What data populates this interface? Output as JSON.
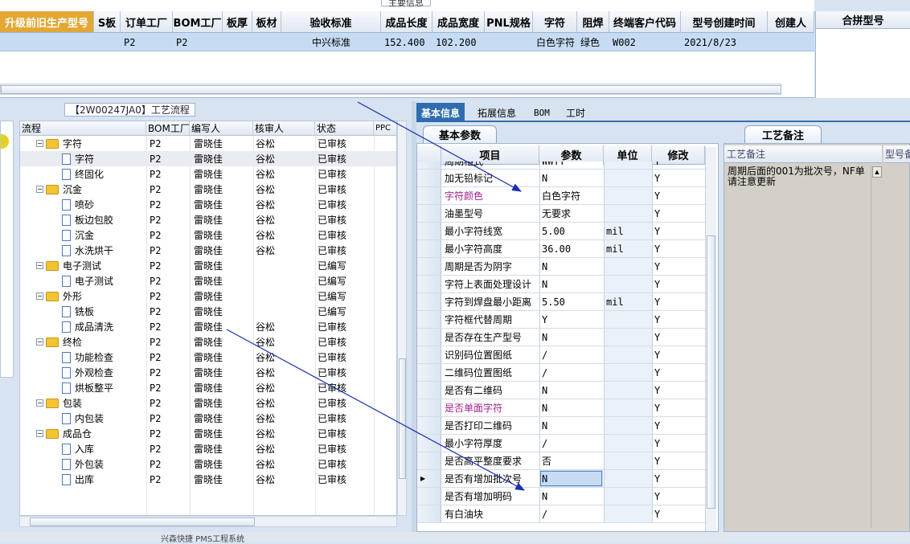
{
  "top_section": {
    "caption": "主要信息",
    "columns": [
      "升级前旧生产型号",
      "S板",
      "订单工厂",
      "BOM工厂",
      "板厚",
      "板材",
      "验收标准",
      "成品长度",
      "成品宽度",
      "PNL规格",
      "字符",
      "阻焊",
      "终端客户代码",
      "型号创建时间",
      "创建人"
    ],
    "row": [
      "",
      "",
      "P2",
      "P2",
      "",
      "",
      "中兴标准",
      "152.400",
      "102.200",
      "",
      "白色字符",
      "绿色",
      "W002",
      "2021/8/23",
      ""
    ],
    "merge_header": "合拼型号"
  },
  "left_section": {
    "caption": "【2W00247JA0】工艺流程",
    "columns": [
      "流程",
      "BOM工厂",
      "编写人",
      "核审人",
      "状态",
      "PPC"
    ],
    "rows": [
      {
        "level": 0,
        "type": "folder",
        "name": "字符",
        "bom": "P2",
        "writer": "雷晓佳",
        "reviewer": "谷松",
        "status": "已审核"
      },
      {
        "level": 1,
        "type": "doc",
        "name": "字符",
        "bom": "P2",
        "writer": "雷晓佳",
        "reviewer": "谷松",
        "status": "已审核",
        "selected": true
      },
      {
        "level": 1,
        "type": "doc",
        "name": "终固化",
        "bom": "P2",
        "writer": "雷晓佳",
        "reviewer": "谷松",
        "status": "已审核"
      },
      {
        "level": 0,
        "type": "folder",
        "name": "沉金",
        "bom": "P2",
        "writer": "雷晓佳",
        "reviewer": "谷松",
        "status": "已审核"
      },
      {
        "level": 1,
        "type": "doc",
        "name": "喷砂",
        "bom": "P2",
        "writer": "雷晓佳",
        "reviewer": "谷松",
        "status": "已审核"
      },
      {
        "level": 1,
        "type": "doc",
        "name": "板边包胶",
        "bom": "P2",
        "writer": "雷晓佳",
        "reviewer": "谷松",
        "status": "已审核"
      },
      {
        "level": 1,
        "type": "doc",
        "name": "沉金",
        "bom": "P2",
        "writer": "雷晓佳",
        "reviewer": "谷松",
        "status": "已审核"
      },
      {
        "level": 1,
        "type": "doc",
        "name": "水洗烘干",
        "bom": "P2",
        "writer": "雷晓佳",
        "reviewer": "谷松",
        "status": "已审核"
      },
      {
        "level": 0,
        "type": "folder",
        "name": "电子测试",
        "bom": "P2",
        "writer": "雷晓佳",
        "reviewer": "",
        "status": "已编写"
      },
      {
        "level": 1,
        "type": "doc",
        "name": "电子测试",
        "bom": "P2",
        "writer": "雷晓佳",
        "reviewer": "",
        "status": "已编写"
      },
      {
        "level": 0,
        "type": "folder",
        "name": "外形",
        "bom": "P2",
        "writer": "雷晓佳",
        "reviewer": "",
        "status": "已编写"
      },
      {
        "level": 1,
        "type": "doc",
        "name": "铣板",
        "bom": "P2",
        "writer": "雷晓佳",
        "reviewer": "",
        "status": "已编写"
      },
      {
        "level": 1,
        "type": "doc",
        "name": "成品清洗",
        "bom": "P2",
        "writer": "雷晓佳",
        "reviewer": "谷松",
        "status": "已审核"
      },
      {
        "level": 0,
        "type": "folder",
        "name": "终检",
        "bom": "P2",
        "writer": "雷晓佳",
        "reviewer": "谷松",
        "status": "已审核"
      },
      {
        "level": 1,
        "type": "doc",
        "name": "功能检查",
        "bom": "P2",
        "writer": "雷晓佳",
        "reviewer": "谷松",
        "status": "已审核"
      },
      {
        "level": 1,
        "type": "doc",
        "name": "外观检查",
        "bom": "P2",
        "writer": "雷晓佳",
        "reviewer": "谷松",
        "status": "已审核"
      },
      {
        "level": 1,
        "type": "doc",
        "name": "烘板整平",
        "bom": "P2",
        "writer": "雷晓佳",
        "reviewer": "谷松",
        "status": "已审核"
      },
      {
        "level": 0,
        "type": "folder",
        "name": "包装",
        "bom": "P2",
        "writer": "雷晓佳",
        "reviewer": "谷松",
        "status": "已审核"
      },
      {
        "level": 1,
        "type": "doc",
        "name": "内包装",
        "bom": "P2",
        "writer": "雷晓佳",
        "reviewer": "谷松",
        "status": "已审核"
      },
      {
        "level": 0,
        "type": "folder",
        "name": "成品仓",
        "bom": "P2",
        "writer": "雷晓佳",
        "reviewer": "谷松",
        "status": "已审核"
      },
      {
        "level": 1,
        "type": "doc",
        "name": "入库",
        "bom": "P2",
        "writer": "雷晓佳",
        "reviewer": "谷松",
        "status": "已审核"
      },
      {
        "level": 1,
        "type": "doc",
        "name": "外包装",
        "bom": "P2",
        "writer": "雷晓佳",
        "reviewer": "谷松",
        "status": "已审核"
      },
      {
        "level": 1,
        "type": "doc",
        "name": "出库",
        "bom": "P2",
        "writer": "雷晓佳",
        "reviewer": "谷松",
        "status": "已审核"
      }
    ]
  },
  "right_section": {
    "tabs": [
      "基本信息",
      "拓展信息",
      "BOM",
      "工时"
    ],
    "active_tab": 0,
    "subtab": "基本参数",
    "remark_tab": "工艺备注",
    "param_columns": [
      "项目",
      "参数",
      "单位",
      "修改"
    ],
    "params": [
      {
        "item": "周期格式",
        "value": "WWYY",
        "unit": "",
        "mod": "Y"
      },
      {
        "item": "加无铅标记",
        "value": "N",
        "unit": "",
        "mod": "Y"
      },
      {
        "item": "字符颜色",
        "value": "白色字符",
        "unit": "",
        "mod": "Y",
        "highlight": true
      },
      {
        "item": "油墨型号",
        "value": "无要求",
        "unit": "",
        "mod": "Y"
      },
      {
        "item": "最小字符线宽",
        "value": "5.00",
        "unit": "mil",
        "mod": "Y"
      },
      {
        "item": "最小字符高度",
        "value": "36.00",
        "unit": "mil",
        "mod": "Y"
      },
      {
        "item": "周期是否为阴字",
        "value": "N",
        "unit": "",
        "mod": "Y"
      },
      {
        "item": "字符上表面处理设计",
        "value": "N",
        "unit": "",
        "mod": "Y"
      },
      {
        "item": "字符到焊盘最小距离",
        "value": "5.50",
        "unit": "mil",
        "mod": "Y"
      },
      {
        "item": "字符框代替周期",
        "value": "Y",
        "unit": "",
        "mod": "Y"
      },
      {
        "item": "是否存在生产型号",
        "value": "N",
        "unit": "",
        "mod": "Y"
      },
      {
        "item": "识别码位置图纸",
        "value": "/",
        "unit": "",
        "mod": "Y"
      },
      {
        "item": "二维码位置图纸",
        "value": "/",
        "unit": "",
        "mod": "Y"
      },
      {
        "item": "是否有二维码",
        "value": "N",
        "unit": "",
        "mod": "Y"
      },
      {
        "item": "是否单面字符",
        "value": "N",
        "unit": "",
        "mod": "Y",
        "highlight": true
      },
      {
        "item": "是否打印二维码",
        "value": "N",
        "unit": "",
        "mod": "Y"
      },
      {
        "item": "最小字符厚度",
        "value": "/",
        "unit": "",
        "mod": "Y"
      },
      {
        "item": "是否高平整度要求",
        "value": "否",
        "unit": "",
        "mod": "Y"
      },
      {
        "item": "是否有增加批次号",
        "value": "N",
        "unit": "",
        "mod": "Y",
        "current": true
      },
      {
        "item": "是否有增加明码",
        "value": "N",
        "unit": "",
        "mod": "Y"
      },
      {
        "item": "有白油块",
        "value": "/",
        "unit": "",
        "mod": "Y"
      }
    ],
    "remark_columns": [
      "工艺备注",
      "型号备注"
    ],
    "remark_text": "周期后面的001为批次号，NF单请注意更新"
  },
  "status_bar": {
    "text": "兴森快捷 PMS工程系统"
  },
  "colors": {
    "accent": "#2f6cb0",
    "header_orange": "#e2a833",
    "selected_row": "#c6dcf3",
    "highlight_text": "#a0208c",
    "arrow": "#1a2fb0"
  }
}
